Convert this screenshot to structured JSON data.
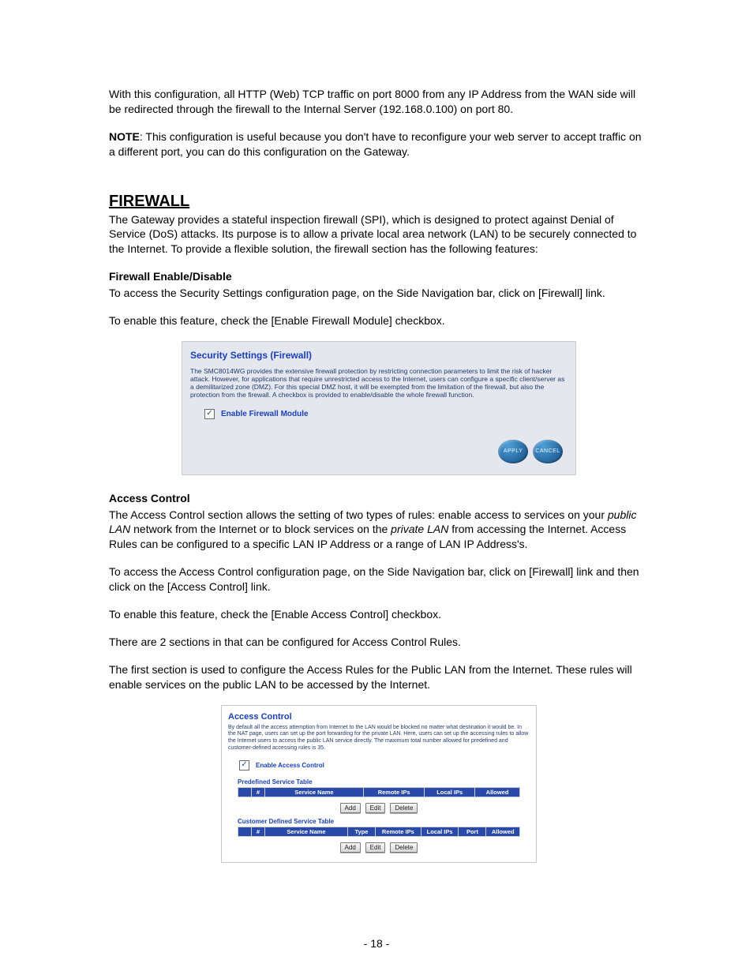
{
  "page_number": "- 18 -",
  "intro_para": "With this configuration, all HTTP (Web) TCP traffic on port 8000 from any IP Address from the WAN side will be redirected through the firewall to the Internal Server (192.168.0.100) on port 80.",
  "note": {
    "label": "NOTE",
    "text": ": This configuration is useful because you don't have to reconfigure your web server to accept traffic on a different port, you can do this configuration on the Gateway."
  },
  "firewall": {
    "heading": "FIREWALL",
    "intro": "The Gateway provides a stateful inspection firewall (SPI), which is designed to protect against Denial of Service (DoS) attacks. Its purpose is to allow a private local area network (LAN) to be securely connected to the Internet. To provide a flexible solution, the firewall section has the following features:",
    "enable_heading": "Firewall Enable/Disable",
    "enable_p1": "To access the Security Settings configuration page, on the Side Navigation bar, click on [Firewall] link.",
    "enable_p2": "To enable this feature, check the [Enable Firewall Module] checkbox."
  },
  "shot1": {
    "title": "Security Settings (Firewall)",
    "desc": "The SMC8014WG provides the extensive firewall protection by restricting connection parameters to limit the risk of hacker attack. However, for applications that require unrestricted access to the Internet, users can configure a specific client/server as a demilitarized zone (DMZ). For this special DMZ host, it will be exempted from the limitation of the firewall, but also the protection from the firewall. A checkbox is provided to enable/disable the whole firewall function.",
    "checkbox_label": "Enable Firewall Module",
    "apply": "APPLY",
    "cancel": "CANCEL"
  },
  "access": {
    "heading": "Access Control",
    "p1_a": "The Access Control section allows the setting of two types of rules: enable access to services on your ",
    "p1_public": "public LAN",
    "p1_b": " network from the Internet or to block services on the ",
    "p1_private": "private LAN",
    "p1_c": " from accessing the Internet. Access Rules can be configured to a specific LAN IP Address or a range of LAN IP Address's.",
    "p2": "To access the Access Control configuration page, on the Side Navigation bar, click on [Firewall] link and then click on the [Access Control] link.",
    "p3": "To enable this feature, check the [Enable Access Control] checkbox.",
    "p4": "There are 2 sections in that can be configured for Access Control Rules.",
    "p5": "The first section is used to configure the Access Rules for the Public LAN from the Internet. These rules will enable services on the public LAN to be accessed by the Internet."
  },
  "shot2": {
    "title": "Access Control",
    "desc": "By default all the access attemption from Internet to the LAN would be blocked no matter what destination it would be. In the NAT page, users can set up the port forwarding for the private LAN. Here, users can set up the accessing rules to allow the Internet users to access the public LAN service directly. The maximum total number allowed for predefined and customer-defined accessing rules is 35.",
    "checkbox_label": "Enable Access Control",
    "predefined_heading": "Predefined Service Table",
    "customer_heading": "Customer Defined Service Table",
    "predef_columns": {
      "chk": " ",
      "num": "#",
      "name": "Service Name",
      "remote": "Remote IPs",
      "local": "Local IPs",
      "allowed": "Allowed"
    },
    "cust_columns": {
      "chk": " ",
      "num": "#",
      "name": "Service Name",
      "type": "Type",
      "remote": "Remote IPs",
      "local": "Local IPs",
      "port": "Port",
      "allowed": "Allowed"
    },
    "btn_add": "Add",
    "btn_edit": "Edit",
    "btn_delete": "Delete"
  }
}
